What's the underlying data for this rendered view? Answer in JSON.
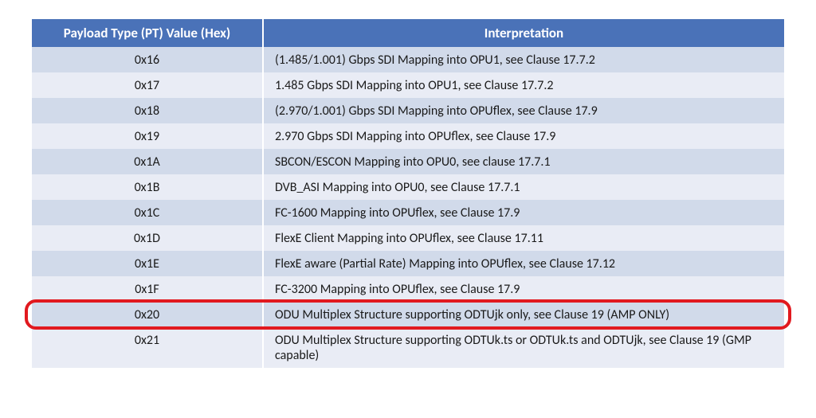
{
  "table": {
    "headers": {
      "pt": "Payload Type (PT) Value (Hex)",
      "interp": "Interpretation"
    },
    "rows": [
      {
        "pt": "0x16",
        "interp": "(1.485/1.001) Gbps SDI Mapping into OPU1, see Clause 17.7.2"
      },
      {
        "pt": "0x17",
        "interp": "1.485 Gbps SDI Mapping into OPU1, see Clause 17.7.2"
      },
      {
        "pt": "0x18",
        "interp": "(2.970/1.001) Gbps SDI Mapping into OPUflex, see Clause 17.9"
      },
      {
        "pt": "0x19",
        "interp": "2.970 Gbps SDI Mapping into OPUflex, see Clause 17.9"
      },
      {
        "pt": "0x1A",
        "interp": "SBCON/ESCON Mapping into OPU0, see clause 17.7.1"
      },
      {
        "pt": "0x1B",
        "interp": "DVB_ASI Mapping into OPU0, see Clause 17.7.1"
      },
      {
        "pt": "0x1C",
        "interp": "FC-1600 Mapping into OPUflex, see Clause 17.9"
      },
      {
        "pt": "0x1D",
        "interp": "FlexE Client Mapping into OPUflex, see Clause 17.11"
      },
      {
        "pt": "0x1E",
        "interp": "FlexE aware (Partial Rate) Mapping into OPUflex, see Clause 17.12"
      },
      {
        "pt": "0x1F",
        "interp": "FC-3200 Mapping into OPUflex, see Clause 17.9"
      },
      {
        "pt": "0x20",
        "interp": "ODU Multiplex Structure supporting ODTUjk only, see Clause 19 (AMP ONLY)",
        "highlight": true
      },
      {
        "pt": "0x21",
        "interp": "ODU Multiplex Structure supporting ODTUk.ts or ODTUk.ts and ODTUjk, see Clause 19 (GMP capable)"
      }
    ]
  }
}
